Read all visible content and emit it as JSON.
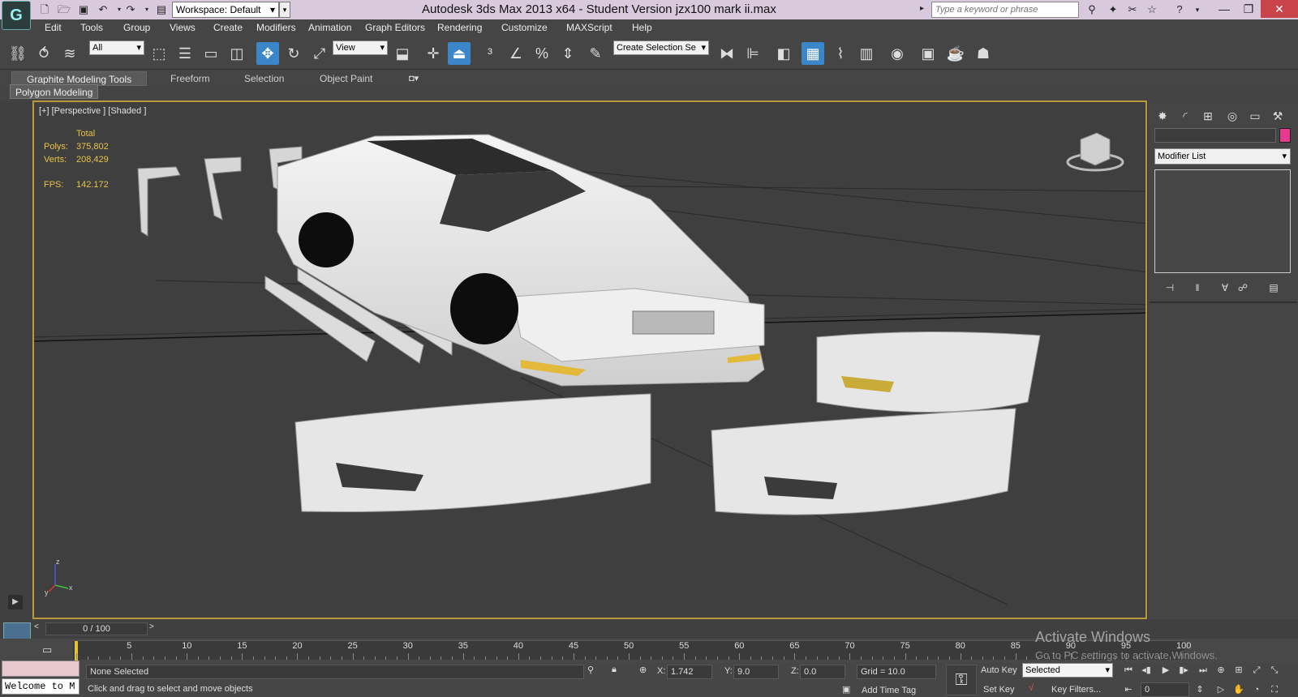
{
  "titlebar": {
    "workspace": "Workspace: Default",
    "title": "Autodesk 3ds Max  2013 x64   - Student Version     jzx100 mark ii.max",
    "search_placeholder": "Type a keyword or phrase"
  },
  "menu": [
    "Edit",
    "Tools",
    "Group",
    "Views",
    "Create",
    "Modifiers",
    "Animation",
    "Graph Editors",
    "Rendering",
    "Customize",
    "MAXScript",
    "Help"
  ],
  "toolbar": {
    "selection_filter": "All",
    "ref_coord": "View",
    "selection_set_placeholder": "Create Selection Se"
  },
  "ribbon": {
    "tabs": [
      "Graphite Modeling Tools",
      "Freeform",
      "Selection",
      "Object Paint"
    ],
    "subtab": "Polygon Modeling"
  },
  "viewport": {
    "label": "[+] [Perspective ] [Shaded ]",
    "stats": {
      "header": "Total",
      "polys_label": "Polys:",
      "polys": "375,802",
      "verts_label": "Verts:",
      "verts": "208,429",
      "fps_label": "FPS:",
      "fps": "142.172"
    },
    "axis": {
      "x": "x",
      "y": "y",
      "z": "z"
    }
  },
  "command_panel": {
    "modifier_list": "Modifier List",
    "object_color": "#e43a8f"
  },
  "timeline": {
    "slider": "0 / 100",
    "ticks": [
      "5",
      "10",
      "15",
      "20",
      "25",
      "30",
      "35",
      "40",
      "45",
      "50",
      "55",
      "60",
      "65",
      "70",
      "75",
      "80",
      "85",
      "90",
      "95",
      "100"
    ]
  },
  "status": {
    "selection": "None Selected",
    "prompt": "Click and drag to select and move objects",
    "x_label": "X:",
    "x": "1.742",
    "y_label": "Y:",
    "y": "9.0",
    "z_label": "Z:",
    "z": "0.0",
    "grid": "Grid = 10.0",
    "add_time_tag": "Add Time Tag",
    "auto_key": "Auto Key",
    "set_key": "Set Key",
    "key_mode": "Selected",
    "key_filters": "Key Filters...",
    "frame": "0",
    "maxscript": "Welcome to M"
  },
  "watermark": {
    "title": "Activate Windows",
    "subtitle": "Go to PC settings to activate Windows."
  }
}
